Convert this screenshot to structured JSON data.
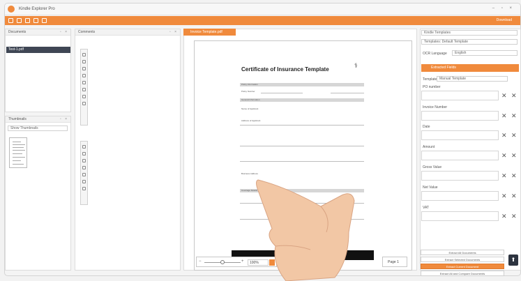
{
  "window": {
    "title": "Kindle Explorer Pro"
  },
  "ribbon": {
    "right_text": "Download"
  },
  "documents_panel": {
    "title": "Documents",
    "item": "Test-1.pdf"
  },
  "thumbnails_panel": {
    "title": "Thumbnails",
    "select": "Show Thumbnails"
  },
  "comments_panel": {
    "title": "Comments"
  },
  "editor": {
    "tab": "Invoice Template.pdf",
    "zoom_value": "100%",
    "page_button": "Page 1"
  },
  "document": {
    "title": "Certificate of Insurance Template",
    "line1": "Policy Information",
    "line2": "Policy Number",
    "line3": "General Information",
    "name_label": "Name of Applicant",
    "address_label": "Address of Applicant",
    "business_label": "Business Address",
    "section2": "Coverage Details"
  },
  "right_panel": {
    "template_select": "Kindle Templates",
    "collections_select": "Templates: Default Template",
    "ocr_label": "OCR Language",
    "ocr_value": "English",
    "fields_header": "Extracted Fields",
    "template_label": "Template",
    "template_value": "Manual Template",
    "fields": [
      "PO number",
      "Invoice Number",
      "Date",
      "Amount",
      "Gross Value",
      "Net Value",
      "VAT"
    ],
    "buttons": [
      "Extract All Documents",
      "Extract Selected Documents",
      "Extract Current Document",
      "Extract All and Compare Documents"
    ]
  }
}
